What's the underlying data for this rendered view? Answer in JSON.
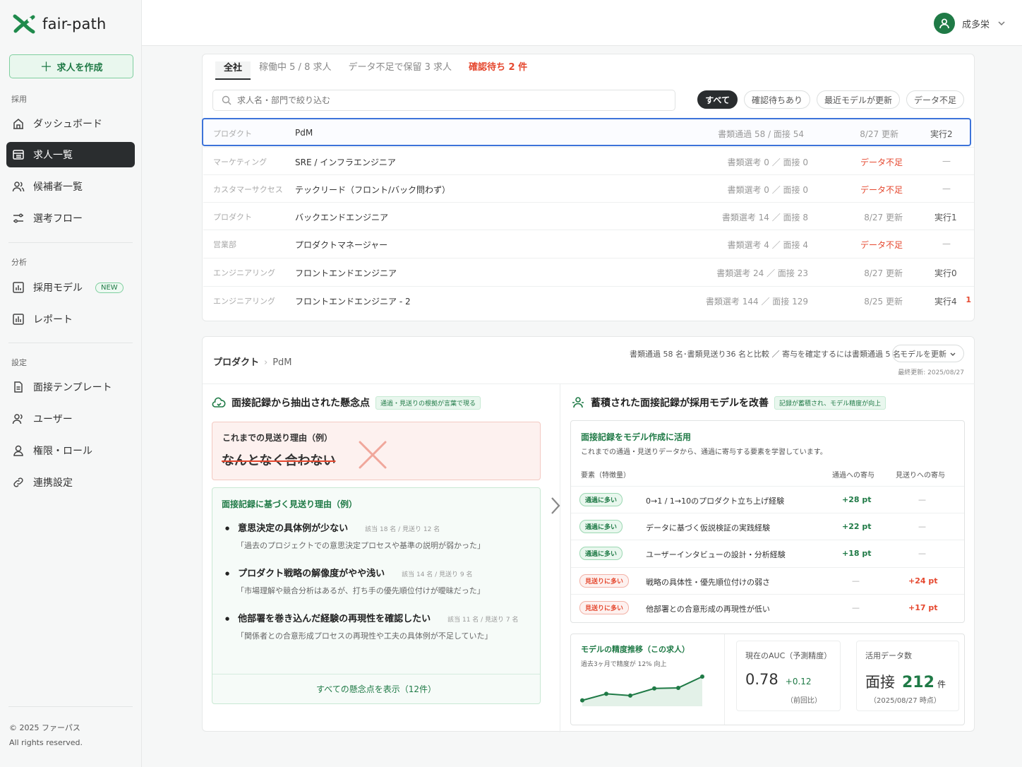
{
  "app": {
    "logo_text": "fair-path"
  },
  "sidebar": {
    "create_label": "求人を作成",
    "sections": [
      {
        "label": "採用",
        "items": [
          {
            "label": "ダッシュボード",
            "icon": "dashboard-icon",
            "active": false
          },
          {
            "label": "求人一覧",
            "icon": "list-icon",
            "active": true
          },
          {
            "label": "候補者一覧",
            "icon": "users-icon",
            "active": false
          },
          {
            "label": "選考フロー",
            "icon": "flow-icon",
            "active": false
          }
        ]
      },
      {
        "label": "分析",
        "items": [
          {
            "label": "採用モデル",
            "icon": "chart-icon",
            "active": false,
            "badge": "NEW"
          },
          {
            "label": "レポート",
            "icon": "report-icon",
            "active": false
          }
        ]
      },
      {
        "label": "設定",
        "items": [
          {
            "label": "面接テンプレート",
            "icon": "document-icon",
            "active": false
          },
          {
            "label": "ユーザー",
            "icon": "user-icon",
            "active": false
          },
          {
            "label": "権限・ロール",
            "icon": "lock-icon",
            "active": false
          },
          {
            "label": "連携設定",
            "icon": "link-icon",
            "active": false
          }
        ]
      }
    ],
    "footer_line1": "© 2025 ファーパス",
    "footer_line2": "All rights reserved."
  },
  "topbar": {
    "user_name": "成多栄"
  },
  "jobs": {
    "tabs": [
      {
        "label": "全社",
        "state": "active"
      },
      {
        "label": "稼働中 5 / 8 求人",
        "state": "normal"
      },
      {
        "label": "データ不足で保留 3 求人",
        "state": "normal"
      },
      {
        "label": "確認待ち 2 件",
        "state": "alert"
      }
    ],
    "search_placeholder": "求人名・部門で絞り込む",
    "filters": [
      {
        "label": "すべて",
        "active": true
      },
      {
        "label": "確認待ちあり",
        "active": false
      },
      {
        "label": "最近モデルが更新",
        "active": false
      },
      {
        "label": "データ不足",
        "active": false
      }
    ],
    "rows": [
      {
        "dept": "プロダクト",
        "title": "PdM",
        "stat": "書類通過 58 / 面接 54",
        "updated": "8/27 更新",
        "warn": false,
        "run": "実行2",
        "badge": ""
      },
      {
        "dept": "マーケティング",
        "title": "SRE / インフラエンジニア",
        "stat": "書類選考 0 ／ 面接 0",
        "updated": "データ不足",
        "warn": true,
        "run": "—",
        "badge": ""
      },
      {
        "dept": "カスタマーサクセス",
        "title": "テックリード（フロント/バック問わず）",
        "stat": "書類選考 0 ／ 面接 0",
        "updated": "データ不足",
        "warn": true,
        "run": "—",
        "badge": ""
      },
      {
        "dept": "プロダクト",
        "title": "バックエンドエンジニア",
        "stat": "書類選考 14 ／ 面接 8",
        "updated": "8/27 更新",
        "warn": false,
        "run": "実行1",
        "badge": ""
      },
      {
        "dept": "営業部",
        "title": "プロダクトマネージャー",
        "stat": "書類選考 4 ／ 面接 4",
        "updated": "データ不足",
        "warn": true,
        "run": "—",
        "badge": ""
      },
      {
        "dept": "エンジニアリング",
        "title": "フロントエンドエンジニア",
        "stat": "書類選考 24 ／ 面接 23",
        "updated": "8/27 更新",
        "warn": false,
        "run": "実行0",
        "badge": ""
      },
      {
        "dept": "エンジニアリング",
        "title": "フロントエンドエンジニア - 2",
        "stat": "書類選考 144 ／ 面接 129",
        "updated": "8/25 更新",
        "warn": false,
        "run": "実行4",
        "badge": "1"
      }
    ]
  },
  "detail": {
    "crumb_parent": "プロダクト",
    "crumb_leaf": "PdM",
    "compare_text": "書類通過 58 名･書類見送り36 名と比較 ／ 寄与を確定するには書類通過 5 名",
    "update_button": "モデルを更新",
    "last_updated": "最終更新: 2025/08/27",
    "left": {
      "title": "面接記録から抽出された懸念点",
      "tag": "通過・見送りの根拠が言葉で現る",
      "old_label": "これまでの見送り理由（例）",
      "old_text": "なんとなく合わない",
      "new_label": "面接記録に基づく見送り理由（例）",
      "reasons": [
        {
          "title": "意思決定の具体例が少ない",
          "meta": "該当 18 名 / 見送り 12 名",
          "quote": "「過去のプロジェクトでの意思決定プロセスや基準の説明が弱かった」"
        },
        {
          "title": "プロダクト戦略の解像度がやや浅い",
          "meta": "該当 14 名 / 見送り 9 名",
          "quote": "「市場理解や競合分析はあるが、打ち手の優先順位付けが曖昧だった」"
        },
        {
          "title": "他部署を巻き込んだ経験の再現性を確認したい",
          "meta": "該当 11 名 / 見送り 7 名",
          "quote": "「関係者との合意形成プロセスの再現性や工夫の具体例が不足していた」"
        }
      ],
      "show_all": "すべての懸念点を表示（12件）"
    },
    "right": {
      "title": "蓄積された面接記録が採用モデルを改善",
      "tag": "記録が蓄積され、モデル精度が向上",
      "model_title": "面接記録をモデル作成に活用",
      "model_desc": "これまでの通過・見送りデータから、通過に寄与する要素を学習しています。",
      "col_feature": "要素（特徴量）",
      "col_pass": "通過への寄与",
      "col_reject": "見送りへの寄与",
      "features": [
        {
          "pill": "通過に多い",
          "kind": "g",
          "label": "0→1 / 1→10のプロダクト立ち上げ経験",
          "pass": "+28 pt",
          "reject": "—"
        },
        {
          "pill": "通過に多い",
          "kind": "g",
          "label": "データに基づく仮説検証の実践経験",
          "pass": "+22 pt",
          "reject": "—"
        },
        {
          "pill": "通過に多い",
          "kind": "g",
          "label": "ユーザーインタビューの設計・分析経験",
          "pass": "+18 pt",
          "reject": "—"
        },
        {
          "pill": "見送りに多い",
          "kind": "r",
          "label": "戦略の具体性・優先順位付けの弱さ",
          "pass": "—",
          "reject": "+24 pt"
        },
        {
          "pill": "見送りに多い",
          "kind": "r",
          "label": "他部署との合意形成の再現性が低い",
          "pass": "—",
          "reject": "+17 pt"
        }
      ],
      "trend_title": "モデルの精度推移（この求人）",
      "trend_sub": "過去3ヶ月で精度が 12% 向上",
      "trend_points": [
        0.2,
        0.42,
        0.36,
        0.6,
        0.62,
        1.0
      ],
      "auc_label": "現在のAUC（予測精度）",
      "auc_value": "0.78",
      "auc_delta": "+0.12",
      "auc_foot": "（前回比）",
      "data_label": "活用データ数",
      "data_kind": "面接",
      "data_count": "212",
      "data_unit": "件",
      "data_foot": "（2025/08/27 時点）"
    }
  },
  "colors": {
    "brand": "#1f7a46",
    "alert": "#e5482f",
    "selected": "#3d73d9",
    "dark": "#2a2d2f"
  }
}
